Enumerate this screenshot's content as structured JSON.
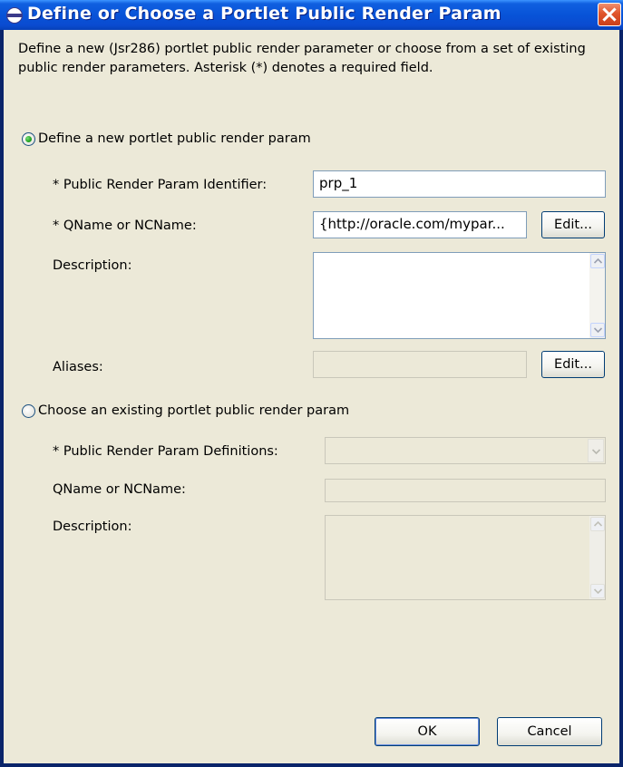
{
  "window": {
    "title": "Define or Choose a Portlet Public Render Param"
  },
  "intro_text": "Define a new (Jsr286) portlet public render parameter or choose from a set of existing public render parameters. Asterisk (*) denotes a required field.",
  "define_section": {
    "radio_label": "Define a new portlet public render param",
    "selected": true,
    "identifier_label": "* Public Render Param Identifier:",
    "identifier_value": "prp_1",
    "qname_label": "* QName or NCName:",
    "qname_value": "{http://oracle.com/mypar...",
    "qname_edit_label": "Edit...",
    "description_label": "Description:",
    "description_value": "",
    "aliases_label": "Aliases:",
    "aliases_value": "",
    "aliases_edit_label": "Edit..."
  },
  "choose_section": {
    "radio_label": "Choose an existing portlet public render param",
    "selected": false,
    "definitions_label": "* Public Render Param Definitions:",
    "definitions_value": "",
    "qname_label": "QName or NCName:",
    "qname_value": "",
    "description_label": "Description:",
    "description_value": ""
  },
  "buttons": {
    "ok_label": "OK",
    "cancel_label": "Cancel"
  },
  "colors": {
    "titlebar": "#0853d8",
    "dialog_bg": "#ece9d8",
    "radio_selected": "#21a121",
    "close_button": "#e0542a"
  }
}
